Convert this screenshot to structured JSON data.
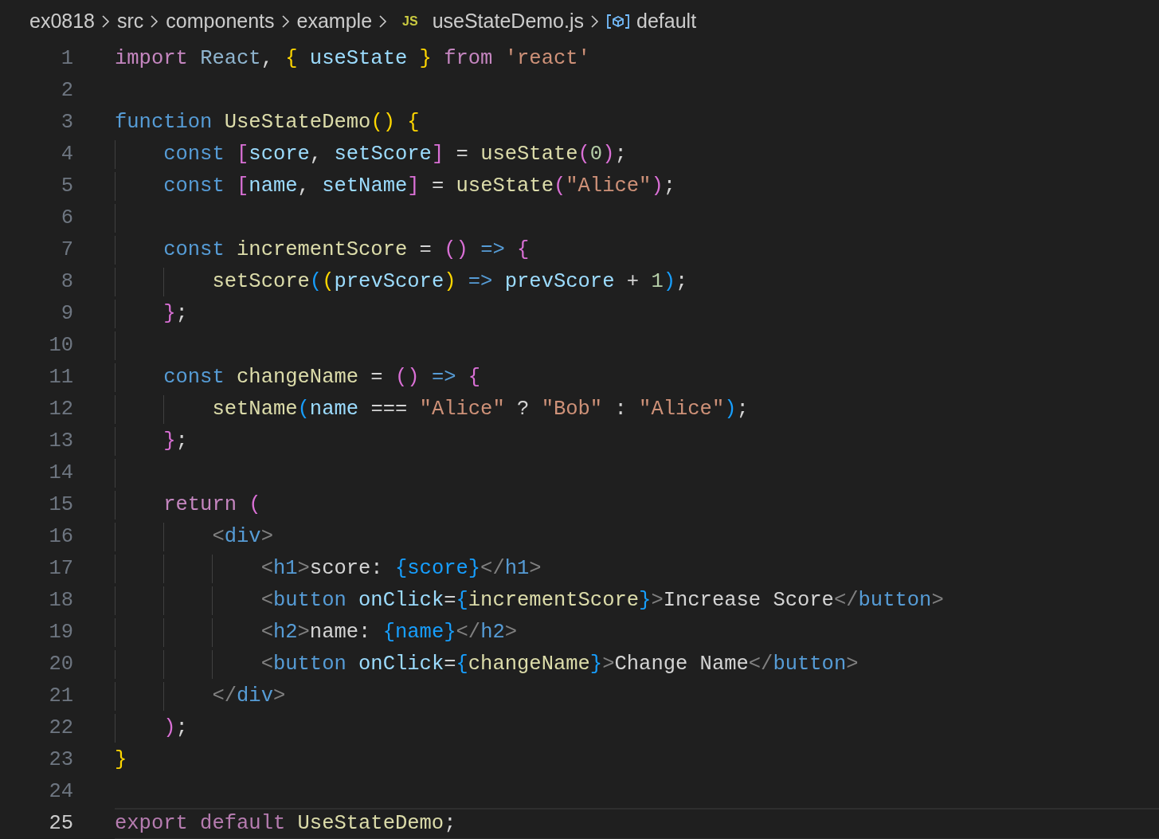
{
  "breadcrumb": [
    {
      "kind": "folder",
      "label": "ex0818"
    },
    {
      "kind": "folder",
      "label": "src"
    },
    {
      "kind": "folder",
      "label": "components"
    },
    {
      "kind": "folder",
      "label": "example"
    },
    {
      "kind": "file",
      "badge": "JS",
      "label": "useStateDemo.js"
    },
    {
      "kind": "symbol",
      "label": "default"
    }
  ],
  "lines": [
    {
      "number": "1",
      "current": false,
      "tokens": [
        {
          "kind": "ctl",
          "text": "import "
        },
        {
          "kind": "mod",
          "text": "React"
        },
        {
          "kind": "p",
          "text": ", "
        },
        {
          "kind": "b1",
          "text": "{ "
        },
        {
          "kind": "var",
          "text": "useState "
        },
        {
          "kind": "b1",
          "text": "} "
        },
        {
          "kind": "ctl",
          "text": "from "
        },
        {
          "kind": "str",
          "text": "'react'"
        }
      ]
    },
    {
      "number": "2",
      "current": false
    },
    {
      "number": "3",
      "current": false,
      "tokens": [
        {
          "kind": "kw",
          "text": "function "
        },
        {
          "kind": "fn",
          "text": "UseStateDemo"
        },
        {
          "kind": "b1",
          "text": "() {"
        }
      ]
    },
    {
      "number": "4",
      "current": false,
      "tokens": [
        {
          "kind": "kw",
          "text": "    const "
        },
        {
          "kind": "b2",
          "text": "["
        },
        {
          "kind": "var",
          "text": "score"
        },
        {
          "kind": "p",
          "text": ", "
        },
        {
          "kind": "var",
          "text": "setScore"
        },
        {
          "kind": "b2",
          "text": "]"
        },
        {
          "kind": "p",
          "text": " = "
        },
        {
          "kind": "fn",
          "text": "useState"
        },
        {
          "kind": "b2",
          "text": "("
        },
        {
          "kind": "num",
          "text": "0"
        },
        {
          "kind": "b2",
          "text": ")"
        },
        {
          "kind": "p",
          "text": ";"
        }
      ]
    },
    {
      "number": "5",
      "current": false,
      "tokens": [
        {
          "kind": "kw",
          "text": "    const "
        },
        {
          "kind": "b2",
          "text": "["
        },
        {
          "kind": "var",
          "text": "name"
        },
        {
          "kind": "p",
          "text": ", "
        },
        {
          "kind": "var",
          "text": "setName"
        },
        {
          "kind": "b2",
          "text": "]"
        },
        {
          "kind": "p",
          "text": " = "
        },
        {
          "kind": "fn",
          "text": "useState"
        },
        {
          "kind": "b2",
          "text": "("
        },
        {
          "kind": "str",
          "text": "\"Alice\""
        },
        {
          "kind": "b2",
          "text": ")"
        },
        {
          "kind": "p",
          "text": ";"
        }
      ]
    },
    {
      "number": "6",
      "current": false
    },
    {
      "number": "7",
      "current": false,
      "tokens": [
        {
          "kind": "kw",
          "text": "    const "
        },
        {
          "kind": "fn",
          "text": "incrementScore"
        },
        {
          "kind": "p",
          "text": " = "
        },
        {
          "kind": "b2",
          "text": "() "
        },
        {
          "kind": "kw",
          "text": "=> "
        },
        {
          "kind": "b2",
          "text": "{"
        }
      ]
    },
    {
      "number": "8",
      "current": false,
      "tokens": [
        {
          "kind": "fn",
          "text": "        setScore"
        },
        {
          "kind": "b3",
          "text": "("
        },
        {
          "kind": "b1",
          "text": "("
        },
        {
          "kind": "var",
          "text": "prevScore"
        },
        {
          "kind": "b1",
          "text": ") "
        },
        {
          "kind": "kw",
          "text": "=> "
        },
        {
          "kind": "var",
          "text": "prevScore"
        },
        {
          "kind": "p",
          "text": " + "
        },
        {
          "kind": "num",
          "text": "1"
        },
        {
          "kind": "b3",
          "text": ")"
        },
        {
          "kind": "p",
          "text": ";"
        }
      ]
    },
    {
      "number": "9",
      "current": false,
      "tokens": [
        {
          "kind": "b2",
          "text": "    }"
        },
        {
          "kind": "p",
          "text": ";"
        }
      ]
    },
    {
      "number": "10",
      "current": false
    },
    {
      "number": "11",
      "current": false,
      "tokens": [
        {
          "kind": "kw",
          "text": "    const "
        },
        {
          "kind": "fn",
          "text": "changeName"
        },
        {
          "kind": "p",
          "text": " = "
        },
        {
          "kind": "b2",
          "text": "() "
        },
        {
          "kind": "kw",
          "text": "=> "
        },
        {
          "kind": "b2",
          "text": "{"
        }
      ]
    },
    {
      "number": "12",
      "current": false,
      "tokens": [
        {
          "kind": "fn",
          "text": "        setName"
        },
        {
          "kind": "b3",
          "text": "("
        },
        {
          "kind": "var",
          "text": "name"
        },
        {
          "kind": "p",
          "text": " === "
        },
        {
          "kind": "str",
          "text": "\"Alice\""
        },
        {
          "kind": "p",
          "text": " ? "
        },
        {
          "kind": "str",
          "text": "\"Bob\""
        },
        {
          "kind": "p",
          "text": " : "
        },
        {
          "kind": "str",
          "text": "\"Alice\""
        },
        {
          "kind": "b3",
          "text": ")"
        },
        {
          "kind": "p",
          "text": ";"
        }
      ]
    },
    {
      "number": "13",
      "current": false,
      "tokens": [
        {
          "kind": "b2",
          "text": "    }"
        },
        {
          "kind": "p",
          "text": ";"
        }
      ]
    },
    {
      "number": "14",
      "current": false
    },
    {
      "number": "15",
      "current": false,
      "tokens": [
        {
          "kind": "ctl",
          "text": "    return "
        },
        {
          "kind": "b2",
          "text": "("
        }
      ]
    },
    {
      "number": "16",
      "current": false,
      "tokens": [
        {
          "kind": "tag",
          "text": "        <"
        },
        {
          "kind": "tn",
          "text": "div"
        },
        {
          "kind": "tag",
          "text": ">"
        }
      ]
    },
    {
      "number": "17",
      "current": false,
      "tokens": [
        {
          "kind": "tag",
          "text": "            <"
        },
        {
          "kind": "tn",
          "text": "h1"
        },
        {
          "kind": "tag",
          "text": ">"
        },
        {
          "kind": "txt",
          "text": "score: "
        },
        {
          "kind": "b3",
          "text": "{score}"
        },
        {
          "kind": "tag",
          "text": "</"
        },
        {
          "kind": "tn",
          "text": "h1"
        },
        {
          "kind": "tag",
          "text": ">"
        }
      ]
    },
    {
      "number": "18",
      "current": false,
      "tokens": [
        {
          "kind": "tag",
          "text": "            <"
        },
        {
          "kind": "tn",
          "text": "button "
        },
        {
          "kind": "var",
          "text": "onClick"
        },
        {
          "kind": "p",
          "text": "="
        },
        {
          "kind": "b3",
          "text": "{"
        },
        {
          "kind": "fn",
          "text": "incrementScore"
        },
        {
          "kind": "b3",
          "text": "}"
        },
        {
          "kind": "tag",
          "text": ">"
        },
        {
          "kind": "txt",
          "text": "Increase Score"
        },
        {
          "kind": "tag",
          "text": "</"
        },
        {
          "kind": "tn",
          "text": "button"
        },
        {
          "kind": "tag",
          "text": ">"
        }
      ]
    },
    {
      "number": "19",
      "current": false,
      "tokens": [
        {
          "kind": "tag",
          "text": "            <"
        },
        {
          "kind": "tn",
          "text": "h2"
        },
        {
          "kind": "tag",
          "text": ">"
        },
        {
          "kind": "txt",
          "text": "name: "
        },
        {
          "kind": "b3",
          "text": "{name}"
        },
        {
          "kind": "tag",
          "text": "</"
        },
        {
          "kind": "tn",
          "text": "h2"
        },
        {
          "kind": "tag",
          "text": ">"
        }
      ]
    },
    {
      "number": "20",
      "current": false,
      "tokens": [
        {
          "kind": "tag",
          "text": "            <"
        },
        {
          "kind": "tn",
          "text": "button "
        },
        {
          "kind": "var",
          "text": "onClick"
        },
        {
          "kind": "p",
          "text": "="
        },
        {
          "kind": "b3",
          "text": "{"
        },
        {
          "kind": "fn",
          "text": "changeName"
        },
        {
          "kind": "b3",
          "text": "}"
        },
        {
          "kind": "tag",
          "text": ">"
        },
        {
          "kind": "txt",
          "text": "Change Name"
        },
        {
          "kind": "tag",
          "text": "</"
        },
        {
          "kind": "tn",
          "text": "button"
        },
        {
          "kind": "tag",
          "text": ">"
        }
      ]
    },
    {
      "number": "21",
      "current": false,
      "tokens": [
        {
          "kind": "tag",
          "text": "        </"
        },
        {
          "kind": "tn",
          "text": "div"
        },
        {
          "kind": "tag",
          "text": ">"
        }
      ]
    },
    {
      "number": "22",
      "current": false,
      "tokens": [
        {
          "kind": "b2",
          "text": "    )"
        },
        {
          "kind": "p",
          "text": ";"
        }
      ]
    },
    {
      "number": "23",
      "current": false,
      "tokens": [
        {
          "kind": "b1",
          "text": "}"
        }
      ]
    },
    {
      "number": "24",
      "current": false
    },
    {
      "number": "25",
      "current": true,
      "tokens": [
        {
          "kind": "ctl2",
          "text": "export default "
        },
        {
          "kind": "fn",
          "text": "UseStateDemo"
        },
        {
          "kind": "p",
          "text": ";"
        }
      ]
    }
  ]
}
